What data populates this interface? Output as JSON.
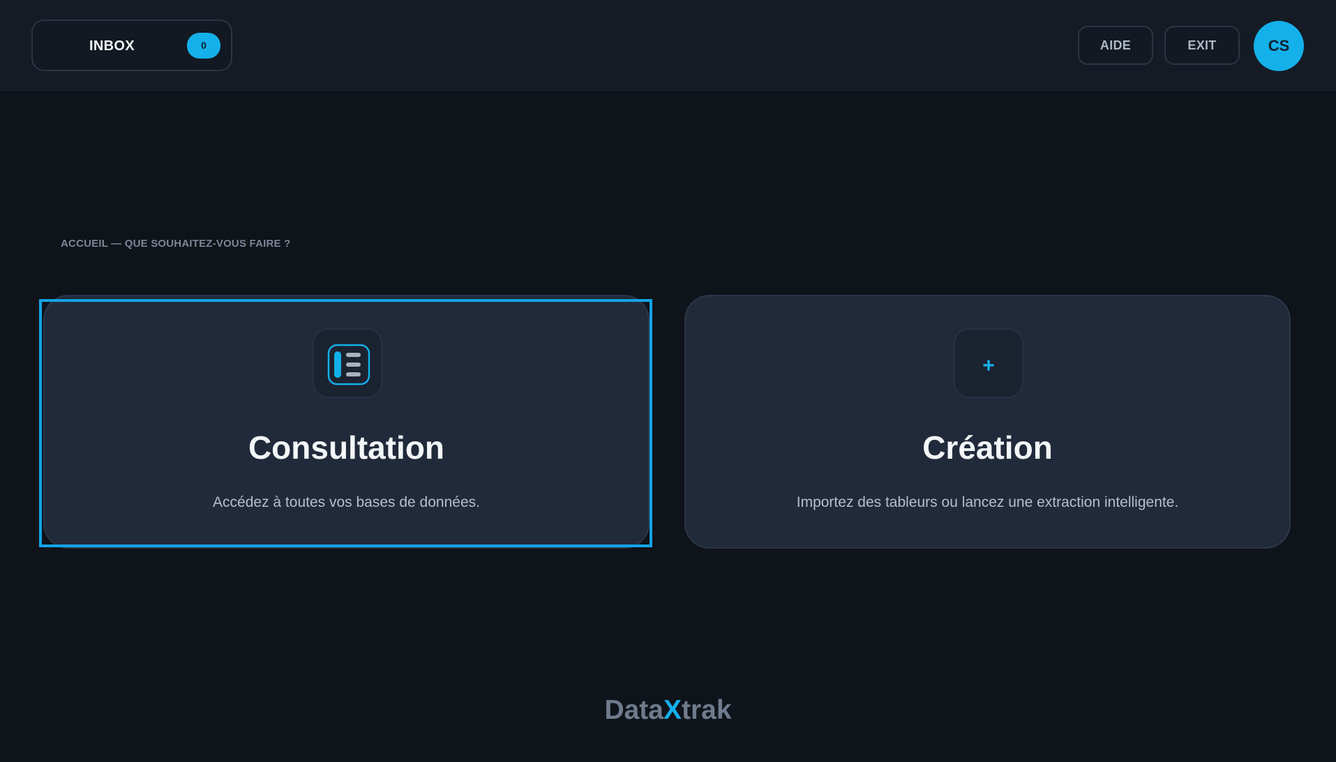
{
  "header": {
    "inbox": {
      "label": "INBOX",
      "count": "0"
    },
    "help_label": "AIDE",
    "exit_label": "EXIT",
    "avatar_initials": "CS"
  },
  "main": {
    "heading": "ACCUEIL — QUE SOUHAITEZ-VOUS FAIRE ?",
    "cards": [
      {
        "title": "Consultation",
        "description": "Accédez à toutes vos bases de données.",
        "icon": "list-icon",
        "selected": true
      },
      {
        "title": "Création",
        "description": "Importez des tableurs ou lancez une extraction intelligente.",
        "icon": "plus-icon",
        "icon_glyph": "+",
        "selected": false
      }
    ]
  },
  "footer": {
    "brand_prefix": "Data",
    "brand_accent": "X",
    "brand_suffix": "trak"
  },
  "colors": {
    "accent": "#13b0ea",
    "background": "#0f131a",
    "header": "#151b25",
    "card": "#212a3a"
  }
}
